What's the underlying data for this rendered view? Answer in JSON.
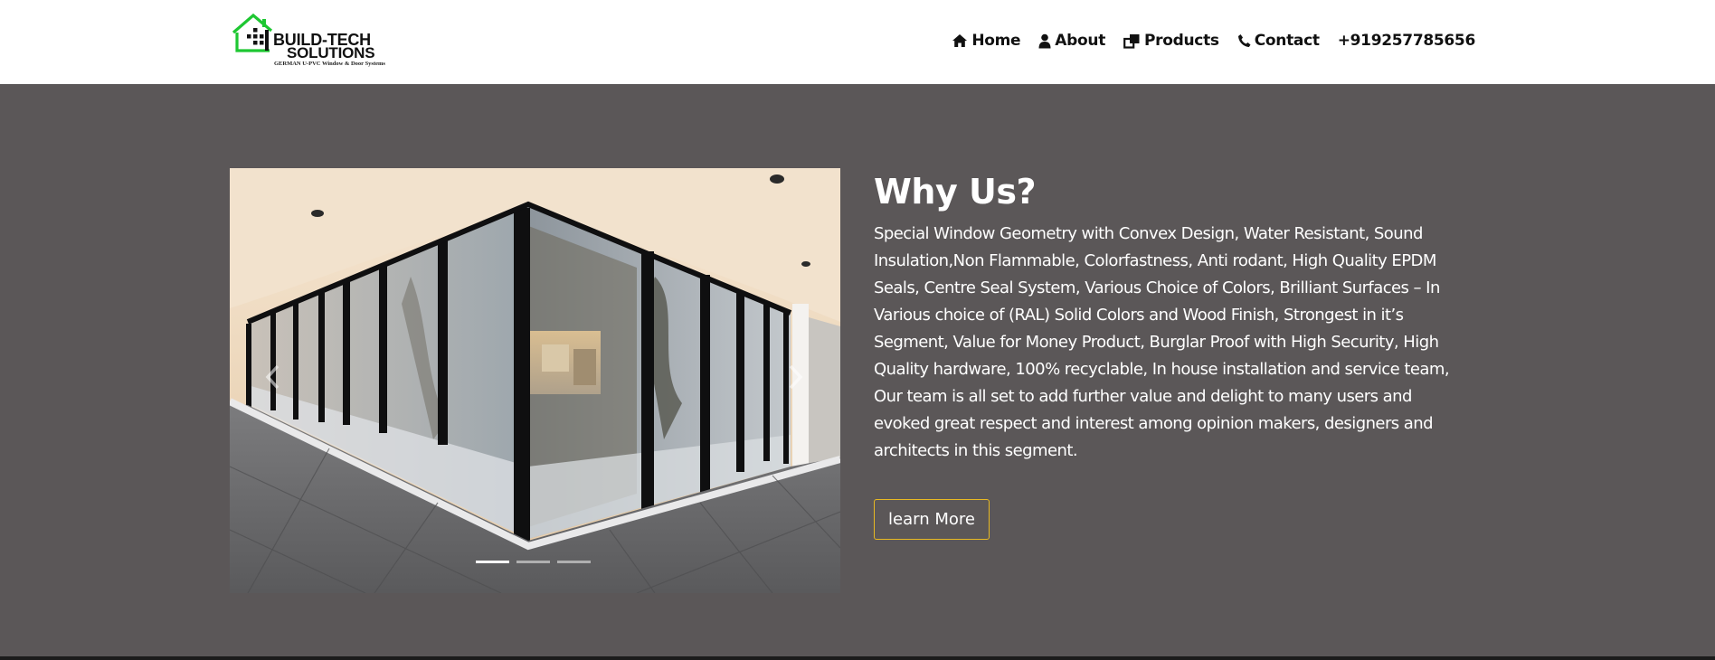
{
  "header": {
    "logo": {
      "line1": "BUILD-TECH",
      "line2": "SOLUTIONS",
      "tagline": "GERMAN U-PVC Window & Door Systems"
    },
    "nav": [
      {
        "label": "Home",
        "icon": "home-icon"
      },
      {
        "label": "About",
        "icon": "user-icon"
      },
      {
        "label": "Products",
        "icon": "clone-icon"
      },
      {
        "label": "Contact",
        "icon": "phone-icon"
      },
      {
        "label": "+919257785656",
        "icon": ""
      }
    ]
  },
  "hero": {
    "heading": "Why Us?",
    "paragraph": "Special Window Geometry with Convex Design, Water Resistant, Sound Insulation,Non Flammable, Colorfastness, Anti rodant, High Quality EPDM Seals, Centre Seal System, Various Choice of Colors, Brilliant Surfaces – In Various choice of (RAL) Solid Colors and Wood Finish, Strongest in it’s Segment, Value for Money Product, Burglar Proof with High Security, High Quality hardware, 100% recyclable, In house installation and service team, Our team is all set to add further value and delight to many users and evoked great respect and interest among opinion makers, designers and architects in this segment.",
    "button_label": "learn More",
    "carousel": {
      "slide_count": 3,
      "active_index": 0,
      "image": "Corner glass sliding windows with black frames on a tiled terrace"
    }
  },
  "colors": {
    "section_bg": "#5b5758",
    "header_bg": "#ffffff",
    "button_border": "#e8b923",
    "logo_green": "#1ec732"
  }
}
